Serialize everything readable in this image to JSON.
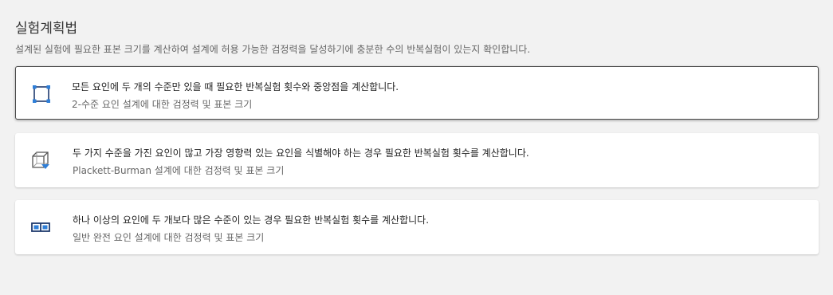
{
  "header": {
    "title": "실험계획법",
    "subtitle": "설계된 실험에 필요한 표본 크기를 계산하여 설계에 허용 가능한 검정력을 달성하기에 충분한 수의 반복실험이 있는지 확인합니다."
  },
  "options": [
    {
      "description": "모든 요인에 두 개의 수준만 있을 때 필요한 반복실험 횟수와 중앙점을 계산합니다.",
      "name": "2-수준 요인 설계에 대한 검정력 및 표본 크기",
      "icon": "two-level-factorial-icon",
      "selected": true
    },
    {
      "description": "두 가지 수준을 가진 요인이 많고 가장 영향력 있는 요인을 식별해야 하는 경우 필요한 반복실험 횟수를 계산합니다.",
      "name": "Plackett-Burman 설계에 대한 검정력 및 표본 크기",
      "icon": "plackett-burman-icon",
      "selected": false
    },
    {
      "description": "하나 이상의 요인에 두 개보다 많은 수준이 있는 경우 필요한 반복실험 횟수를 계산합니다.",
      "name": "일반 완전 요인 설계에 대한 검정력 및 표본 크기",
      "icon": "general-full-factorial-icon",
      "selected": false
    }
  ],
  "colors": {
    "icon_navy": "#1f3a6e",
    "icon_blue": "#2f7fd8",
    "selected_border": "#4a4a4a"
  }
}
